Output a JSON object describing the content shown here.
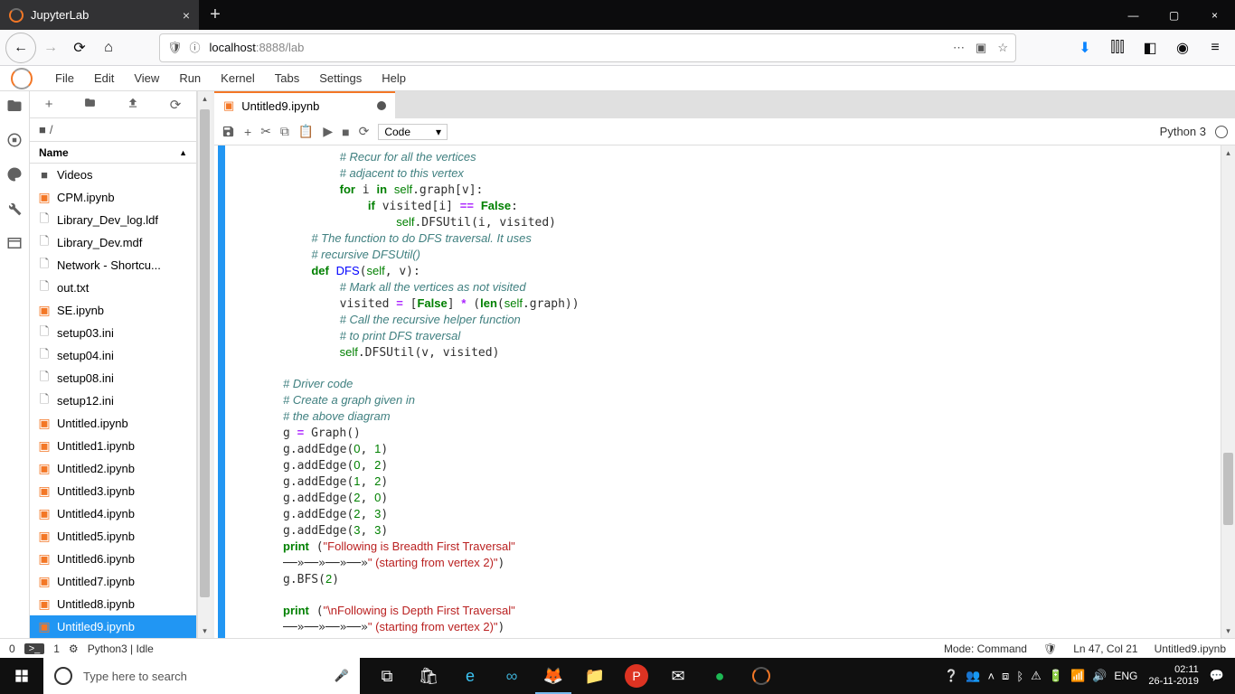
{
  "browser": {
    "tab_title": "JupyterLab",
    "url_prefix": "localhost",
    "url_suffix": ":8888/lab",
    "new_tab": "+",
    "close": "×",
    "minimize": "—",
    "maximize": "▢"
  },
  "menu": [
    "File",
    "Edit",
    "View",
    "Run",
    "Kernel",
    "Tabs",
    "Settings",
    "Help"
  ],
  "file_tools": {
    "new": "+",
    "new_folder": "📁",
    "upload": "⬆",
    "refresh": "⟳"
  },
  "breadcrumb": "/",
  "col_head": "Name",
  "files": [
    {
      "name": "Videos",
      "type": "folder"
    },
    {
      "name": "CPM.ipynb",
      "type": "nb"
    },
    {
      "name": "Library_Dev_log.ldf",
      "type": "file"
    },
    {
      "name": "Library_Dev.mdf",
      "type": "file"
    },
    {
      "name": "Network - Shortcu...",
      "type": "file"
    },
    {
      "name": "out.txt",
      "type": "file"
    },
    {
      "name": "SE.ipynb",
      "type": "nb"
    },
    {
      "name": "setup03.ini",
      "type": "file"
    },
    {
      "name": "setup04.ini",
      "type": "file"
    },
    {
      "name": "setup08.ini",
      "type": "file"
    },
    {
      "name": "setup12.ini",
      "type": "file"
    },
    {
      "name": "Untitled.ipynb",
      "type": "nb"
    },
    {
      "name": "Untitled1.ipynb",
      "type": "nb"
    },
    {
      "name": "Untitled2.ipynb",
      "type": "nb"
    },
    {
      "name": "Untitled3.ipynb",
      "type": "nb"
    },
    {
      "name": "Untitled4.ipynb",
      "type": "nb"
    },
    {
      "name": "Untitled5.ipynb",
      "type": "nb"
    },
    {
      "name": "Untitled6.ipynb",
      "type": "nb"
    },
    {
      "name": "Untitled7.ipynb",
      "type": "nb"
    },
    {
      "name": "Untitled8.ipynb",
      "type": "nb"
    },
    {
      "name": "Untitled9.ipynb",
      "type": "nb",
      "selected": true
    }
  ],
  "nb_tab_name": "Untitled9.ipynb",
  "cell_type": "Code",
  "kernel_name": "Python 3",
  "status": {
    "left_terms": "0",
    "left_kern": "1",
    "kernel": "Python3 | Idle",
    "mode": "Mode: Command",
    "ln_col": "Ln 47, Col 21",
    "notebook": "Untitled9.ipynb"
  },
  "taskbar": {
    "search_placeholder": "Type here to search",
    "lang": "ENG",
    "time": "02:11",
    "date": "26-11-2019"
  }
}
